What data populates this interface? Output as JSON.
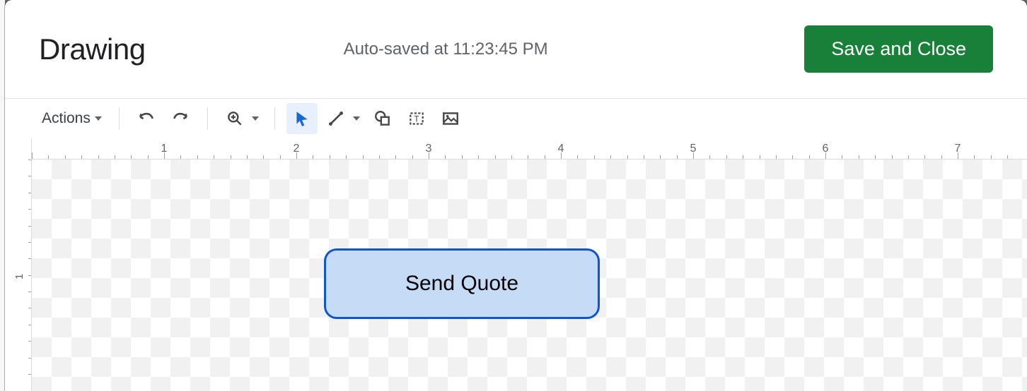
{
  "header": {
    "title": "Drawing",
    "autosave": "Auto-saved at 11:23:45 PM",
    "save_button": "Save and Close"
  },
  "toolbar": {
    "actions_label": "Actions"
  },
  "ruler": {
    "h_labels": [
      "1",
      "2",
      "3",
      "4",
      "5",
      "6",
      "7"
    ],
    "v_labels": [
      "1"
    ]
  },
  "canvas": {
    "shape_text": "Send Quote"
  }
}
